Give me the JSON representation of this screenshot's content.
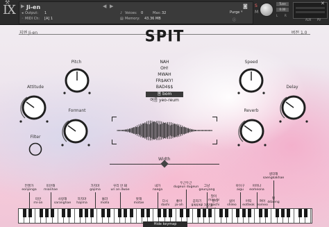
{
  "header": {
    "instrument_name": "Ji-en",
    "output_label": "Output:",
    "output_value": "1",
    "midi_label": "MIDI Ch:",
    "midi_value": "[A] 1",
    "voices_label": "Voices:",
    "voices_value": "0",
    "max_label": "Max:",
    "max_value": "32",
    "memory_label": "Memory:",
    "memory_value": "43.36 MB",
    "purge_label": "Purge",
    "tune_label": "Tune",
    "tune_value": "0.00",
    "s_label": "S",
    "m_label": "M",
    "l_label": "L",
    "r_label": "R",
    "aux_label": "AUX",
    "pv_label": "PV",
    "logo": "IX"
  },
  "instrument": {
    "artist_name": "지엔 Ji-en",
    "version": "버전 1.0",
    "title": "SPIT"
  },
  "knobs": {
    "pitch": "Pitch",
    "speed": "Speed",
    "attitude": "Attitude",
    "delay": "Delay",
    "formant": "Formant",
    "reverb": "Reverb",
    "filter": "Filter",
    "width": "Width"
  },
  "words": [
    {
      "text": "NAH",
      "selected": false
    },
    {
      "text": "OH!",
      "selected": false
    },
    {
      "text": "MWAH",
      "selected": false
    },
    {
      "text": "FR$AKY!",
      "selected": false
    },
    {
      "text": "BAD4$$",
      "selected": false
    },
    {
      "text": "봄 bom",
      "selected": true
    },
    {
      "text": "여름 yeo-reum",
      "selected": false
    }
  ],
  "keymap": {
    "upper": [
      {
        "ko": "언젠가",
        "ro": "eonjenga"
      },
      {
        "ko": "미안해",
        "ro": "mianhae"
      },
      {
        "ko": "가지마",
        "ro": "gajima"
      },
      {
        "ko": "우리 안 돼",
        "ro": "uri an dwae"
      },
      {
        "ko": "내가",
        "ro": "naega"
      },
      {
        "ko": "두근두근",
        "ro": "dugeun dugeun"
      },
      {
        "ko": "그냥",
        "ro": "geunyang"
      },
      {
        "ko": "아이구",
        "ro": "aigu"
      },
      {
        "ko": "어머나",
        "ro": "eomeona"
      },
      {
        "ko": "생각해",
        "ro": "saengkakhae"
      }
    ],
    "lower": [
      {
        "ko": "미안",
        "ro": "mi-an"
      },
      {
        "ko": "사랑해",
        "ro": "saranghae"
      },
      {
        "ko": "하지마",
        "ro": "hajima"
      },
      {
        "ko": "몰라",
        "ro": "molla"
      },
      {
        "ko": "못해",
        "ro": "motae"
      },
      {
        "ko": "다시",
        "ro": "dashi"
      },
      {
        "ko": "좋아",
        "ro": "jo-ah"
      },
      {
        "ko": "갑자기",
        "ro": "gapjagi"
      },
      {
        "ko": "같이",
        "ro": "gachi"
      },
      {
        "ko": "거짓말",
        "ro": "geojinmal"
      },
      {
        "ko": "많이",
        "ro": "man-hi"
      },
      {
        "ko": "싫어",
        "ro": "shileo"
      },
      {
        "ko": "어떡",
        "ro": "eotteok"
      },
      {
        "ko": "여어",
        "ro": "eomeo"
      },
      {
        "ko": "땡",
        "ro": "ddaeng"
      }
    ],
    "octaves": [
      "C1",
      "C2",
      "C3",
      "C4",
      "C5",
      "C6"
    ],
    "hide_label": "Hide keymap"
  }
}
